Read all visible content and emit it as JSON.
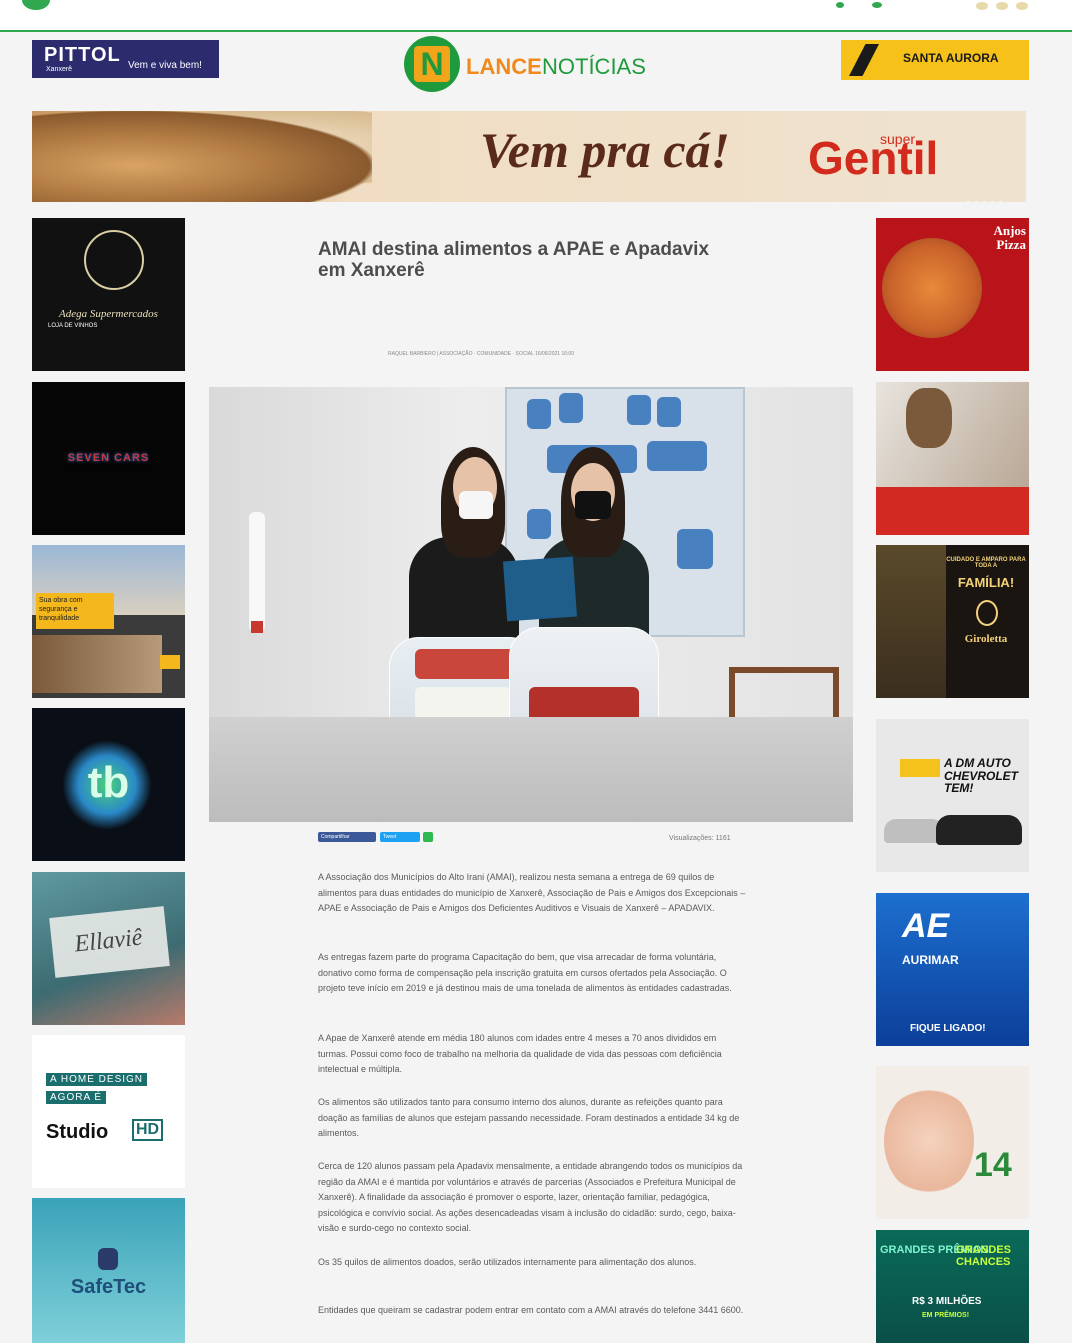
{
  "header": {
    "left_ad": {
      "brand": "PITTOL",
      "sub": "Xanxerê",
      "slogan": "Vem e viva bem!"
    },
    "logo": {
      "letter": "N",
      "word1": "LANCE",
      "word2": "NOTÍCIAS"
    },
    "right_ad": {
      "brand": "SANTA AURORA"
    }
  },
  "banner": {
    "headline": "Vem pra cá!",
    "super_label": "super",
    "brand": "Gentil"
  },
  "left_ads": [
    {
      "label": "Adega Supermercados",
      "sub": "LOJA DE VINHOS"
    },
    {
      "label": "SEVEN CARS"
    },
    {
      "label": "Sua obra com segurança e tranquilidade"
    },
    {
      "label": "tb"
    },
    {
      "label": "Ellaviê"
    },
    {
      "label1": "A HOME DESIGN",
      "label2": "AGORA É",
      "label3": "Studio",
      "label4": "HD"
    },
    {
      "label": "SafeTec"
    }
  ],
  "right_ads": [
    {
      "label": "Anjos Pizza"
    },
    {
      "label": ""
    },
    {
      "label1": "CUIDADO E AMPARO PARA TODA A",
      "label2": "FAMÍLIA!",
      "label3": "Giroletta"
    },
    {
      "label1": "A DM AUTO",
      "label2": "CHEVROLET",
      "label3": "TEM!"
    },
    {
      "label1": "AE",
      "label2": "AURIMAR",
      "label3": "FIQUE LIGADO!"
    },
    {
      "label": "14"
    },
    {
      "label1": "GRANDES PRÊMIOS",
      "label2": "GRANDES CHANCES",
      "label3": "R$ 3 MILHÕES",
      "label4": "EM PRÊMIOS!"
    }
  ],
  "article": {
    "title": "AMAI destina alimentos a APAE e Apadavix em Xanxerê",
    "byline": "RAQUEL BARBIERO | ASSOCIAÇÃO · COMUNIDADE · SOCIAL 16/06/2021 16:00",
    "share_facebook": "Compartilhar",
    "share_twitter": "Tweet",
    "views": "Visualizações: 1161",
    "paragraphs": [
      "A Associação dos Municípios do Alto Irani (AMAI), realizou nesta semana a entrega de 69 quilos de alimentos para duas entidades do município de Xanxerê, Associação de Pais e Amigos dos Excepcionais – APAE e Associação de Pais e Amigos dos Deficientes Auditivos e Visuais de Xanxerê – APADAVIX.",
      "As entregas fazem parte do programa Capacitação do bem, que visa arrecadar de forma voluntária, donativo como forma de compensação pela inscrição gratuita em cursos ofertados pela Associação. O projeto teve início em 2019 e já destinou mais de uma tonelada de alimentos às entidades cadastradas.",
      "A Apae de Xanxerê atende em média 180 alunos com idades entre 4 meses a 70 anos divididos em turmas. Possui como foco de trabalho na melhoria da qualidade de vida das pessoas com deficiência intelectual e múltipla.",
      "Os alimentos são utilizados tanto para consumo interno dos alunos, durante as refeições quanto para doação as famílias de alunos que estejam passando necessidade. Foram destinados a entidade 34 kg de alimentos.",
      "Cerca de 120 alunos passam pela Apadavix mensalmente, a entidade abrangendo todos os municípios da região da AMAI e é mantida por voluntários e através de parcerias (Associados e Prefeitura Municipal de Xanxerê). A finalidade da associação é promover o esporte, lazer, orientação familiar, pedagógica, psicológica e convívio social. As ações desencadeadas visam à inclusão do cidadão: surdo, cego, baixa-visão e surdo-cego no contexto social.",
      "Os 35 quilos de alimentos doados, serão utilizados internamente para alimentação dos alunos.",
      "Entidades que queiram se cadastrar podem entrar em contato com a AMAI através do telefone 3441 6600."
    ]
  }
}
